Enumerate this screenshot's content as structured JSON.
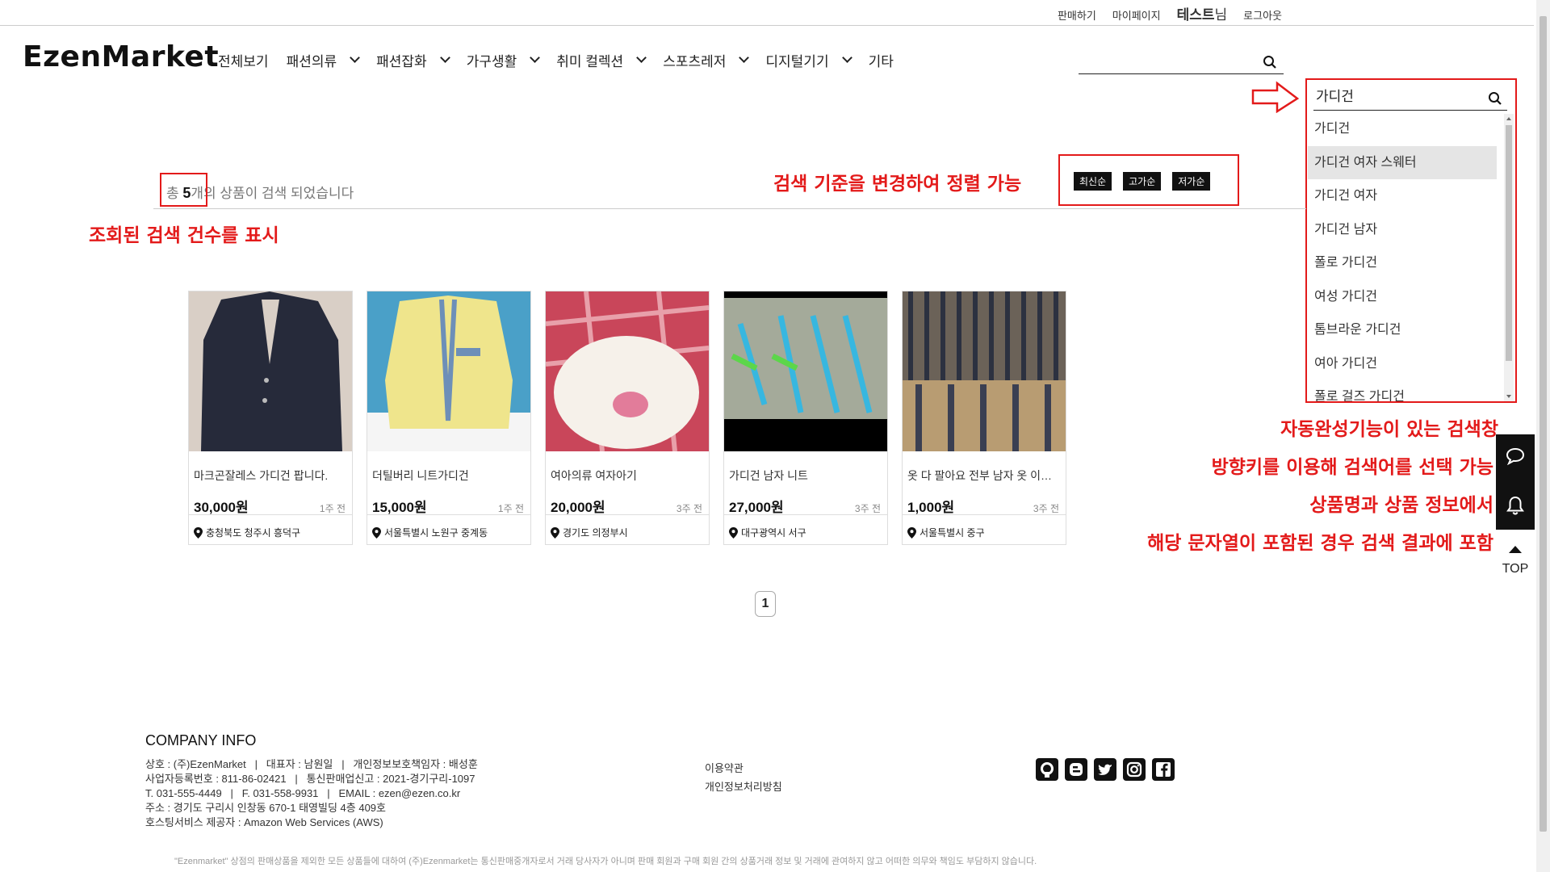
{
  "topbar": {
    "sell": "판매하기",
    "mypage": "마이페이지",
    "user": "테스트",
    "user_suffix": "님",
    "logout": "로그아웃"
  },
  "header": {
    "logo": "EzenMarket",
    "nav": [
      "전체보기",
      "패션의류",
      "패션잡화",
      "가구생활",
      "취미 컬렉션",
      "스포츠레저",
      "디지털기기",
      "기타"
    ]
  },
  "autocomplete": {
    "query": "가디건",
    "suggestions": [
      "가디건",
      "가디건 여자 스웨터",
      "가디건 여자",
      "가디건 남자",
      "폴로 가디건",
      "여성 가디건",
      "톰브라운 가디건",
      "여아 가디건",
      "폴로 걸즈 가디건"
    ],
    "selected_index": 1
  },
  "results": {
    "prefix": "총 ",
    "count": "5",
    "suffix": "개의 상품이 검색 되었습니다"
  },
  "sort": [
    "최신순",
    "고가순",
    "저가순"
  ],
  "annotations": {
    "sort_note": "검색 기준을 변경하여 정렬 가능",
    "count_note": "조회된 검색 건수를  표시",
    "ac_note_1": "자동완성기능이 있는 검색창",
    "ac_note_2": "방향키를 이용해 검색어를 선택 가능",
    "ac_note_3": "상품명과 상품 정보에서",
    "ac_note_4": "해당 문자열이 포함된 경우 검색 결과에 포함"
  },
  "products": [
    {
      "name": "마크곤잘레스 가디건 팝니다.",
      "price": "30,000원",
      "time": "1주 전",
      "location": "충청북도 청주시 흥덕구"
    },
    {
      "name": "더틸버리 니트가디건",
      "price": "15,000원",
      "time": "1주 전",
      "location": "서울특별시 노원구 중계동"
    },
    {
      "name": "여아의류 여자아기",
      "price": "20,000원",
      "time": "3주 전",
      "location": "경기도 의정부시"
    },
    {
      "name": "가디건 남자 니트",
      "price": "27,000원",
      "time": "3주 전",
      "location": "대구광역시 서구"
    },
    {
      "name": "옷 다 팔아요 전부 남자 옷 이…",
      "price": "1,000원",
      "time": "3주 전",
      "location": "서울특별시 중구"
    }
  ],
  "pagination": {
    "current": "1"
  },
  "side": {
    "top_label": "TOP"
  },
  "footer": {
    "title": "COMPANY INFO",
    "lines": [
      "상호 : (주)EzenMarket   |   대표자 : 남원일   |   개인정보보호책임자 : 배성훈",
      "사업자등록번호 : 811-86-02421   |   통신판매업신고 : 2021-경기구리-1097",
      "T. 031-555-4449   |   F. 031-558-9931   |   EMAIL : ezen@ezen.co.kr",
      "주소 : 경기도 구리시 인창동 670-1 태영빌딩 4층 409호",
      "호스팅서비스 제공자 : Amazon Web Services (AWS)"
    ],
    "links": [
      "이용약관",
      "개인정보처리방침"
    ],
    "social_icons": [
      "github-icon",
      "blogger-icon",
      "twitter-icon",
      "instagram-icon",
      "facebook-icon"
    ],
    "disclaimer": "\"Ezenmarket\" 상점의 판매상품을 제외한 모든 상품들에 대하여 (주)Ezenmarket는 통신판매중개자로서 거래 당사자가 아니며 판매 회원과 구매 회원 간의 상품거래 정보 및 거래에 관여하지 않고 어떠한 의무와 책임도 부담하지 않습니다."
  },
  "colors": {
    "annotation": "#e31a1a",
    "sort_button": "#111111"
  }
}
